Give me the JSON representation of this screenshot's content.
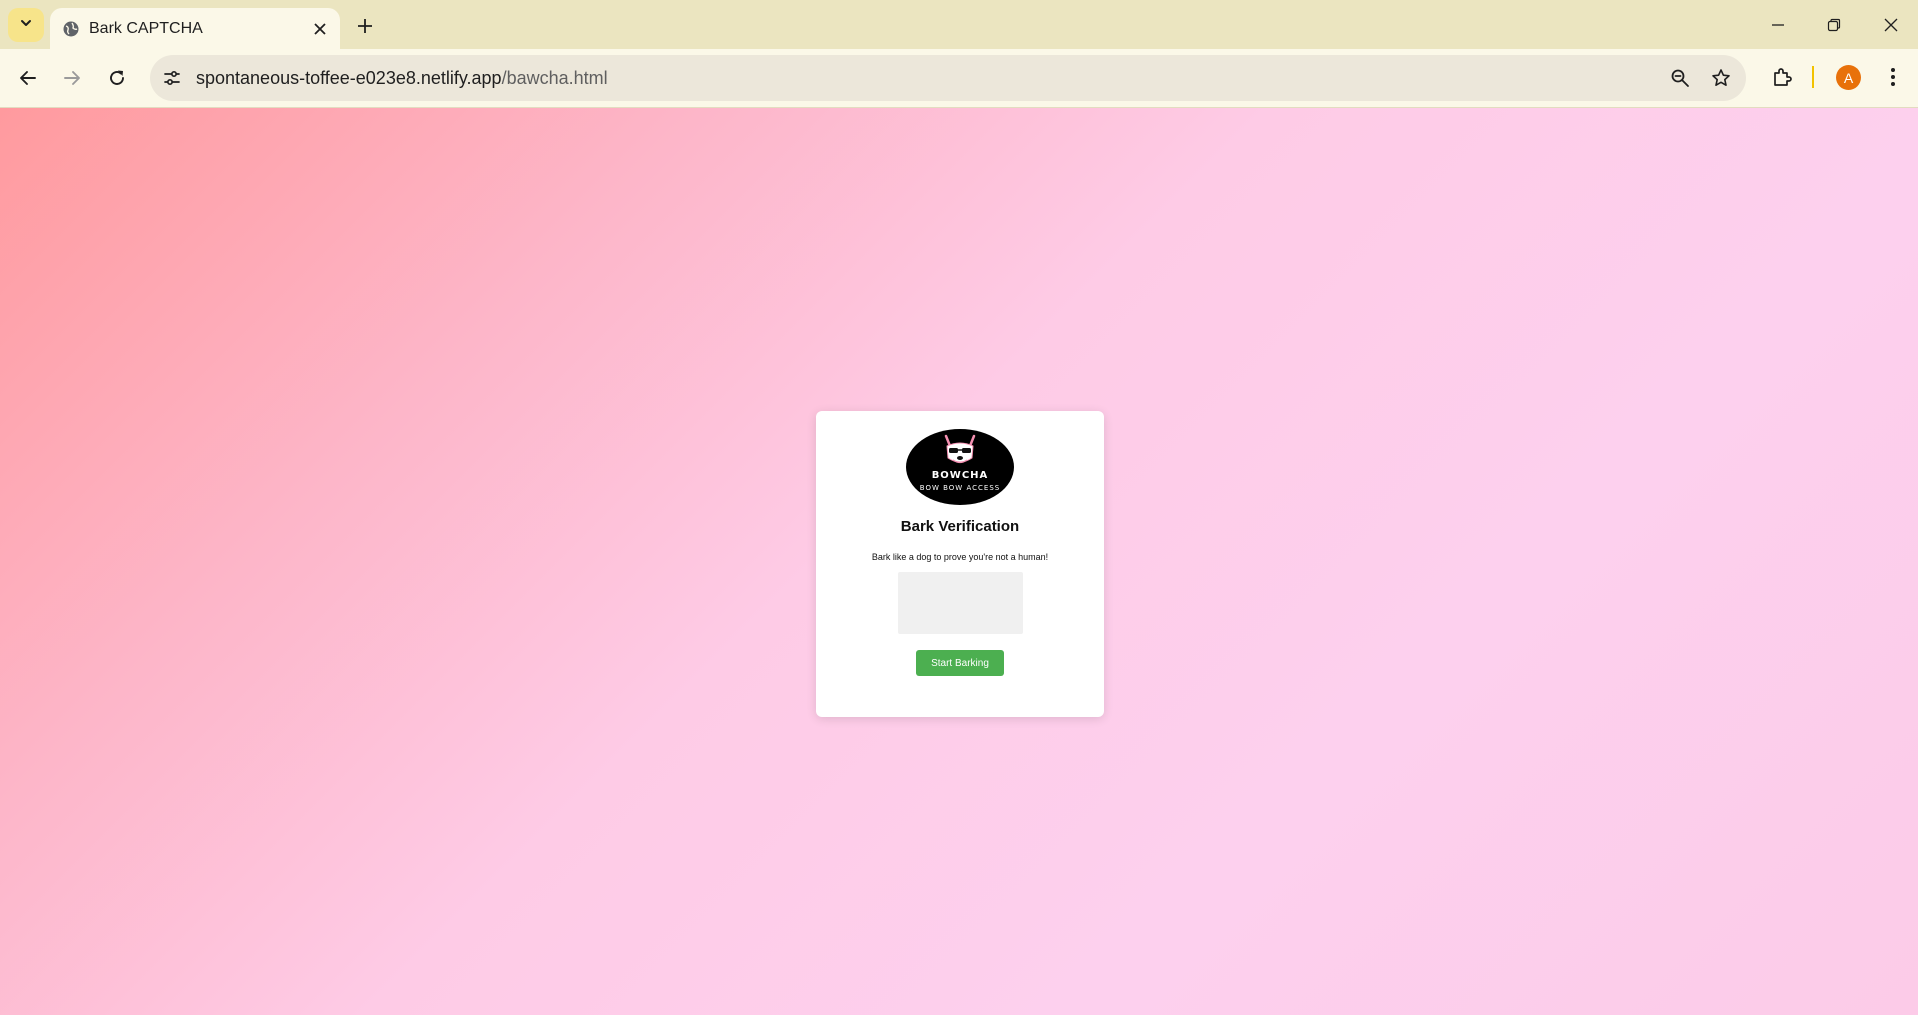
{
  "browser": {
    "tab_title": "Bark CAPTCHA",
    "url_host": "spontaneous-toffee-e023e8.netlify.app",
    "url_path": "/bawcha.html",
    "avatar_letter": "A",
    "accent_color": "#e8710a"
  },
  "card": {
    "logo_title": "BOWCHA",
    "logo_subtitle": "BOW BOW ACCESS",
    "heading": "Bark Verification",
    "instruction": "Bark like a dog to prove you're not a human!",
    "button_label": "Start Barking",
    "button_color": "#4caf50"
  }
}
